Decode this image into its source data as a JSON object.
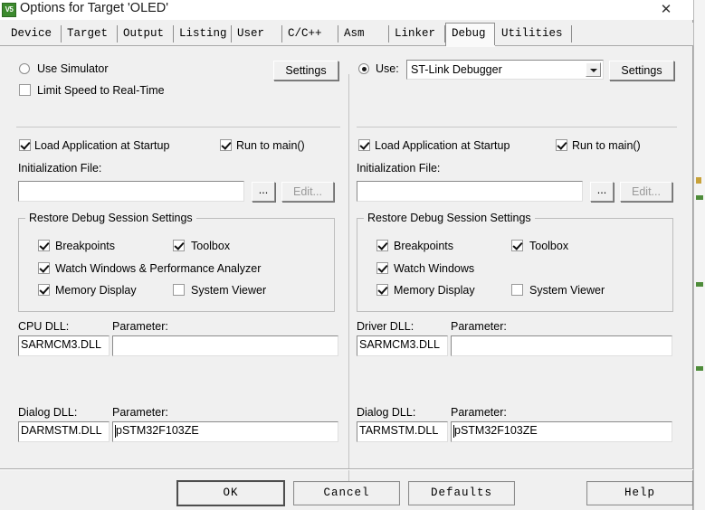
{
  "window": {
    "title": "Options for Target 'OLED'",
    "icon_label": "V5",
    "close_label": "✕"
  },
  "tabs": [
    {
      "label": "Device",
      "selected": false
    },
    {
      "label": "Target",
      "selected": false
    },
    {
      "label": "Output",
      "selected": false
    },
    {
      "label": "Listing",
      "selected": false
    },
    {
      "label": "User",
      "selected": false
    },
    {
      "label": "C/C++",
      "selected": false
    },
    {
      "label": "Asm",
      "selected": false
    },
    {
      "label": "Linker",
      "selected": false
    },
    {
      "label": "Debug",
      "selected": true
    },
    {
      "label": "Utilities",
      "selected": false
    }
  ],
  "left_panel": {
    "use_simulator": {
      "label": "Use Simulator",
      "checked": false
    },
    "limit_speed": {
      "label": "Limit Speed to Real-Time",
      "checked": false
    },
    "settings_button": "Settings",
    "load_app": {
      "label": "Load Application at Startup",
      "checked": true
    },
    "run_to_main": {
      "label": "Run to main()",
      "checked": true
    },
    "init_file_label": "Initialization File:",
    "init_file_value": "",
    "browse_button": "...",
    "edit_button": "Edit...",
    "group": {
      "title": "Restore Debug Session Settings",
      "breakpoints": {
        "label": "Breakpoints",
        "checked": true
      },
      "toolbox": {
        "label": "Toolbox",
        "checked": true
      },
      "watch_windows": {
        "label": "Watch Windows & Performance Analyzer",
        "checked": true
      },
      "memory_display": {
        "label": "Memory Display",
        "checked": true
      },
      "system_viewer": {
        "label": "System Viewer",
        "checked": false
      }
    },
    "cpu_dll_label": "CPU DLL:",
    "cpu_dll_value": "SARMCM3.DLL",
    "cpu_param_label": "Parameter:",
    "cpu_param_value": "",
    "dialog_dll_label": "Dialog DLL:",
    "dialog_dll_value": "DARMSTM.DLL",
    "dialog_param_label": "Parameter:",
    "dialog_param_value": "pSTM32F103ZE"
  },
  "right_panel": {
    "use_radio": {
      "label": "Use:",
      "checked": true
    },
    "debugger_selected": "ST-Link Debugger",
    "settings_button": "Settings",
    "load_app": {
      "label": "Load Application at Startup",
      "checked": true
    },
    "run_to_main": {
      "label": "Run to main()",
      "checked": true
    },
    "init_file_label": "Initialization File:",
    "init_file_value": "",
    "browse_button": "...",
    "edit_button": "Edit...",
    "group": {
      "title": "Restore Debug Session Settings",
      "breakpoints": {
        "label": "Breakpoints",
        "checked": true
      },
      "toolbox": {
        "label": "Toolbox",
        "checked": true
      },
      "watch_windows": {
        "label": "Watch Windows",
        "checked": true
      },
      "memory_display": {
        "label": "Memory Display",
        "checked": true
      },
      "system_viewer": {
        "label": "System Viewer",
        "checked": false
      }
    },
    "driver_dll_label": "Driver DLL:",
    "driver_dll_value": "SARMCM3.DLL",
    "driver_param_label": "Parameter:",
    "driver_param_value": "",
    "dialog_dll_label": "Dialog DLL:",
    "dialog_dll_value": "TARMSTM.DLL",
    "dialog_param_label": "Parameter:",
    "dialog_param_value": "pSTM32F103ZE"
  },
  "footer": {
    "ok": "OK",
    "cancel": "Cancel",
    "defaults": "Defaults",
    "help": "Help"
  }
}
